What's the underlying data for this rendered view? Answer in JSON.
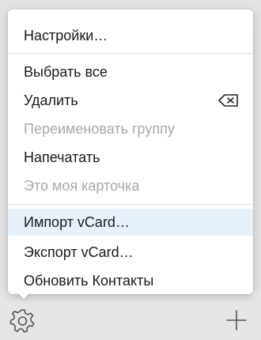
{
  "menu": {
    "items": [
      {
        "label": "Настройки…",
        "disabled": false
      },
      {
        "label": "Выбрать все",
        "disabled": false
      },
      {
        "label": "Удалить",
        "disabled": false,
        "icon": "delete-backspace-icon"
      },
      {
        "label": "Переименовать группу",
        "disabled": true
      },
      {
        "label": "Напечатать",
        "disabled": false
      },
      {
        "label": "Это моя карточка",
        "disabled": true
      },
      {
        "label": "Импорт vCard…",
        "disabled": false,
        "highlighted": true
      },
      {
        "label": "Экспорт vCard…",
        "disabled": false
      },
      {
        "label": "Обновить Контакты",
        "disabled": false
      }
    ]
  },
  "toolbar": {
    "icons": [
      "gear-icon",
      "plus-icon"
    ]
  },
  "colors": {
    "highlight": "#e7f1fb",
    "disabled_text": "#a9a9a9",
    "text": "#1a1a1a",
    "background": "#e3e3e3"
  }
}
